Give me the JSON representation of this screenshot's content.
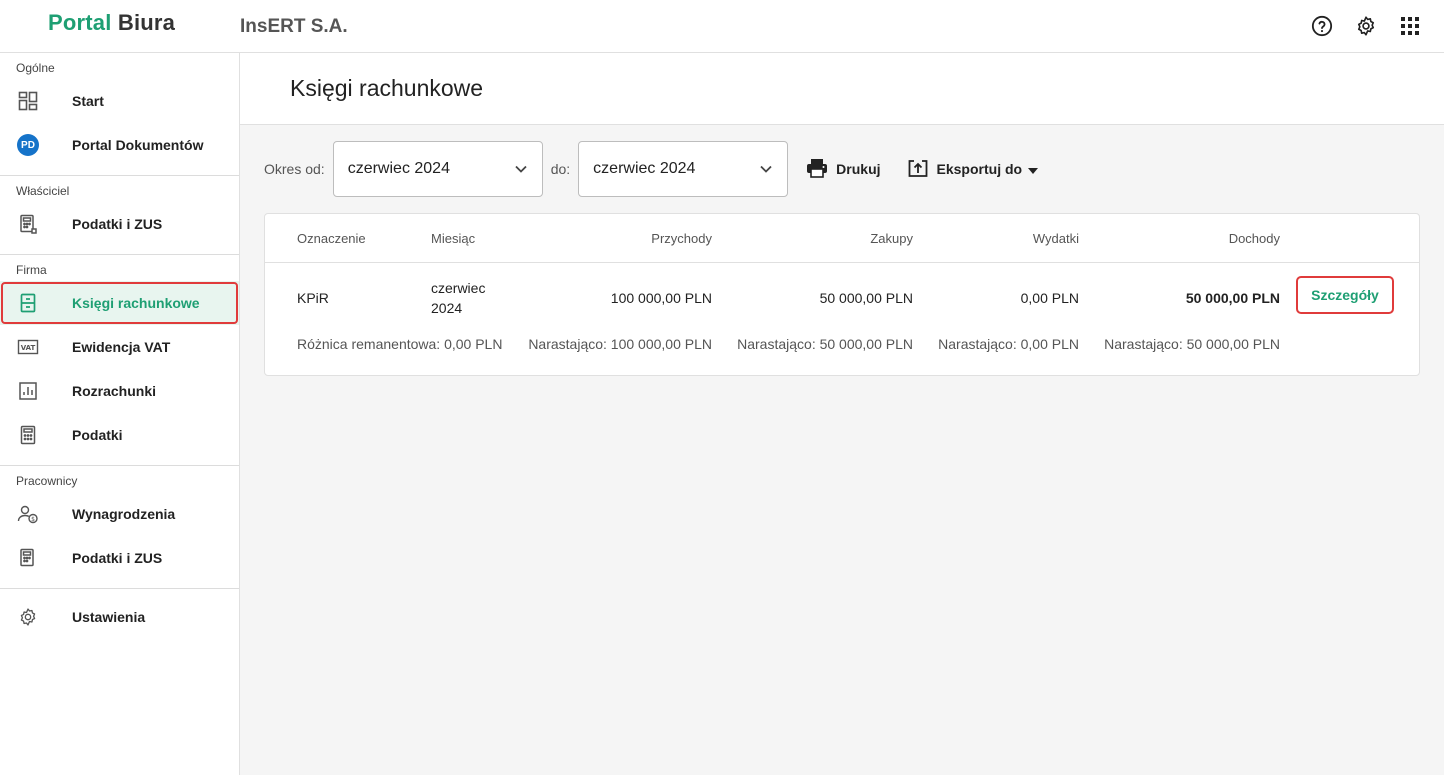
{
  "header": {
    "logo_part1": "Portal",
    "logo_part2": "Biura",
    "company": "InsERT S.A.",
    "icons": [
      "help-icon",
      "settings-icon",
      "apps-grid-icon"
    ]
  },
  "sidebar": {
    "sections": [
      {
        "title": "Ogólne",
        "items": [
          {
            "label": "Start",
            "icon": "dashboard-icon"
          },
          {
            "label": "Portal Dokumentów",
            "icon": "pd-badge",
            "badge": "PD"
          }
        ]
      },
      {
        "title": "Właściciel",
        "items": [
          {
            "label": "Podatki i ZUS",
            "icon": "calculator-icon"
          }
        ]
      },
      {
        "title": "Firma",
        "items": [
          {
            "label": "Księgi rachunkowe",
            "icon": "ledger-icon",
            "active": true
          },
          {
            "label": "Ewidencja VAT",
            "icon": "vat-icon"
          },
          {
            "label": "Rozrachunki",
            "icon": "chart-icon"
          },
          {
            "label": "Podatki",
            "icon": "calculator-icon"
          }
        ]
      },
      {
        "title": "Pracownicy",
        "items": [
          {
            "label": "Wynagrodzenia",
            "icon": "salary-icon"
          },
          {
            "label": "Podatki i ZUS",
            "icon": "calculator-icon"
          }
        ]
      },
      {
        "title": "",
        "items": [
          {
            "label": "Ustawienia",
            "icon": "gear-icon"
          }
        ]
      }
    ]
  },
  "main": {
    "title": "Księgi rachunkowe",
    "filters": {
      "from_label": "Okres od:",
      "from_value": "czerwiec 2024",
      "to_label": "do:",
      "to_value": "czerwiec 2024",
      "print_label": "Drukuj",
      "export_label": "Eksportuj do"
    },
    "table": {
      "headers": [
        "Oznaczenie",
        "Miesiąc",
        "Przychody",
        "Zakupy",
        "Wydatki",
        "Dochody"
      ],
      "row": {
        "oznaczenie": "KPiR",
        "miesiac_line1": "czerwiec",
        "miesiac_line2": "2024",
        "przychody": "100 000,00 PLN",
        "zakupy": "50 000,00 PLN",
        "wydatki": "0,00 PLN",
        "dochody": "50 000,00 PLN",
        "details_label": "Szczegóły",
        "sub_roznica": "Różnica remanentowa: 0,00 PLN",
        "sub_przychody": "Narastająco: 100 000,00 PLN",
        "sub_zakupy": "Narastająco: 50 000,00 PLN",
        "sub_wydatki": "Narastająco: 0,00 PLN",
        "sub_dochody": "Narastająco: 50 000,00 PLN"
      }
    }
  },
  "colors": {
    "brand": "#1e9f73",
    "highlight": "#e03b3b",
    "pd_badge": "#1573c9"
  }
}
